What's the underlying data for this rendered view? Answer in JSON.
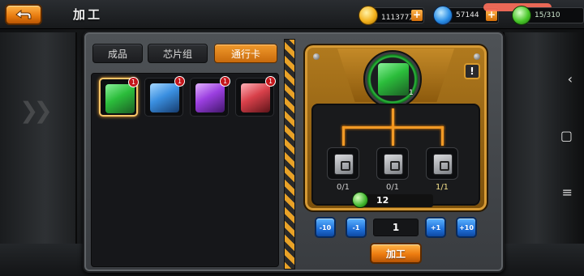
{
  "header": {
    "title": "加工",
    "resources": {
      "gold": "111377万",
      "gems": "57144",
      "energy": "15/310"
    }
  },
  "tabs": [
    {
      "label": "成品",
      "active": false
    },
    {
      "label": "芯片组",
      "active": false
    },
    {
      "label": "通行卡",
      "active": true
    }
  ],
  "items": [
    {
      "color": "green",
      "badge": "1",
      "selected": true
    },
    {
      "color": "blue",
      "badge": "1",
      "selected": false
    },
    {
      "color": "purple",
      "badge": "1",
      "selected": false
    },
    {
      "color": "red",
      "badge": "1",
      "selected": false
    }
  ],
  "craft": {
    "target_count": "1",
    "info_label": "!",
    "materials": [
      {
        "count": "0/1",
        "sufficient": false
      },
      {
        "count": "0/1",
        "sufficient": false
      },
      {
        "count": "1/1",
        "sufficient": true
      }
    ],
    "cost": "12"
  },
  "quantity": {
    "minus10": "-10",
    "minus1": "-1",
    "value": "1",
    "plus1": "+1",
    "plus10": "+10"
  },
  "craft_button": "加工",
  "colors": {
    "accent_orange": "#ed7c10",
    "button_blue": "#1f6fd8",
    "green_item": "#2bbd3b",
    "blue_item": "#3a8fe0",
    "purple_item": "#9b3fe0",
    "red_item": "#d8404a"
  }
}
